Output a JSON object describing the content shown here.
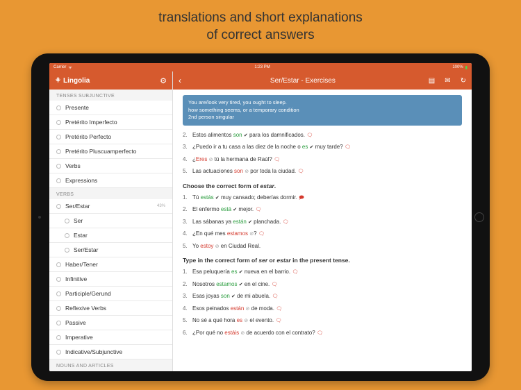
{
  "promo": {
    "line1": "translations and short explanations",
    "line2": "of correct answers"
  },
  "statusbar": {
    "carrier": "Carrier",
    "wifi": "᯾",
    "time": "1:23 PM",
    "battery": "100%"
  },
  "sidebar": {
    "brand": "Lingolia",
    "section1": "TENSES SUBJUNCTIVE",
    "items1": [
      {
        "label": "Presente"
      },
      {
        "label": "Pretérito Imperfecto"
      },
      {
        "label": "Pretérito Perfecto"
      },
      {
        "label": "Pretérito Pluscuamperfecto"
      },
      {
        "label": "Verbs"
      },
      {
        "label": "Expressions"
      }
    ],
    "section2": "VERBS",
    "items2": [
      {
        "label": "Ser/Estar",
        "pct": "43%"
      },
      {
        "label": "Ser",
        "sub": true
      },
      {
        "label": "Estar",
        "sub": true
      },
      {
        "label": "Ser/Estar",
        "sub": true
      },
      {
        "label": "Haber/Tener"
      },
      {
        "label": "Infinitive"
      },
      {
        "label": "Participle/Gerund"
      },
      {
        "label": "Reflexive Verbs"
      },
      {
        "label": "Passive"
      },
      {
        "label": "Imperative"
      },
      {
        "label": "Indicative/Subjunctive"
      }
    ],
    "section3": "NOUNS AND ARTICLES"
  },
  "main": {
    "title": "Ser/Estar - Exercises",
    "tooltip": {
      "l1": "You are/look very tired, you ought to sleep.",
      "l2": "how something seems, or a temporary condition",
      "l3": "2nd person singular"
    },
    "block1": [
      {
        "n": "2.",
        "pre": "Estos alimentos ",
        "ans": "son",
        "cls": "green",
        "mark": "check",
        "post": " para los damnificados.",
        "bubble": "o"
      },
      {
        "n": "3.",
        "pre": "¿Puedo ir a tu casa a las diez de la noche o ",
        "ans": "es",
        "cls": "green",
        "mark": "check",
        "post": " muy tarde?",
        "bubble": "o"
      },
      {
        "n": "4.",
        "pre": "¿",
        "ans": "Eres",
        "cls": "red",
        "mark": "x",
        "post": " tú la hermana de Raúl?",
        "bubble": "o"
      },
      {
        "n": "5.",
        "pre": "Las actuaciones ",
        "ans": "son",
        "cls": "red",
        "mark": "x",
        "post": " por toda la ciudad.",
        "bubble": "o"
      }
    ],
    "instr2": "Choose the correct form of estar.",
    "block2": [
      {
        "n": "1.",
        "pre": "Tú ",
        "ans": "estás",
        "cls": "green",
        "mark": "check",
        "post": " muy cansado; deberías dormir.",
        "bubble": "f"
      },
      {
        "n": "2.",
        "pre": "El enfermo ",
        "ans": "está",
        "cls": "green",
        "mark": "check",
        "post": " mejor.",
        "bubble": "o"
      },
      {
        "n": "3.",
        "pre": "Las sábanas ya ",
        "ans": "están",
        "cls": "green",
        "mark": "check",
        "post": " planchada.",
        "bubble": "o"
      },
      {
        "n": "4.",
        "pre": "¿En qué mes ",
        "ans": "estamos",
        "cls": "red",
        "mark": "x",
        "post": "?",
        "bubble": "o"
      },
      {
        "n": "5.",
        "pre": "Yo ",
        "ans": "estoy",
        "cls": "red",
        "mark": "x",
        "post": " en Ciudad Real.",
        "bubble": ""
      }
    ],
    "instr3": "Type in the correct form of ser or estar in the present tense.",
    "block3": [
      {
        "n": "1.",
        "pre": "Esa peluquería ",
        "ans": "es",
        "cls": "green",
        "mark": "check",
        "post": " nueva en el barrio.",
        "bubble": "o"
      },
      {
        "n": "2.",
        "pre": "Nosotros ",
        "ans": "estamos",
        "cls": "green",
        "mark": "check",
        "post": " en el cine.",
        "bubble": "o"
      },
      {
        "n": "3.",
        "pre": "Esas joyas ",
        "ans": "son",
        "cls": "green",
        "mark": "check",
        "post": " de mi abuela.",
        "bubble": "o"
      },
      {
        "n": "4.",
        "pre": "Esos peinados ",
        "ans": "están",
        "cls": "red",
        "mark": "x",
        "post": " de moda.",
        "bubble": "o"
      },
      {
        "n": "5.",
        "pre": "No sé a qué hora ",
        "ans": "es",
        "cls": "red",
        "mark": "x",
        "post": " el evento.",
        "bubble": "o"
      },
      {
        "n": "6.",
        "pre": "¿Por qué no ",
        "ans": "estáis",
        "cls": "red",
        "mark": "x",
        "post": " de acuerdo con el contrato?",
        "bubble": "o"
      }
    ]
  }
}
